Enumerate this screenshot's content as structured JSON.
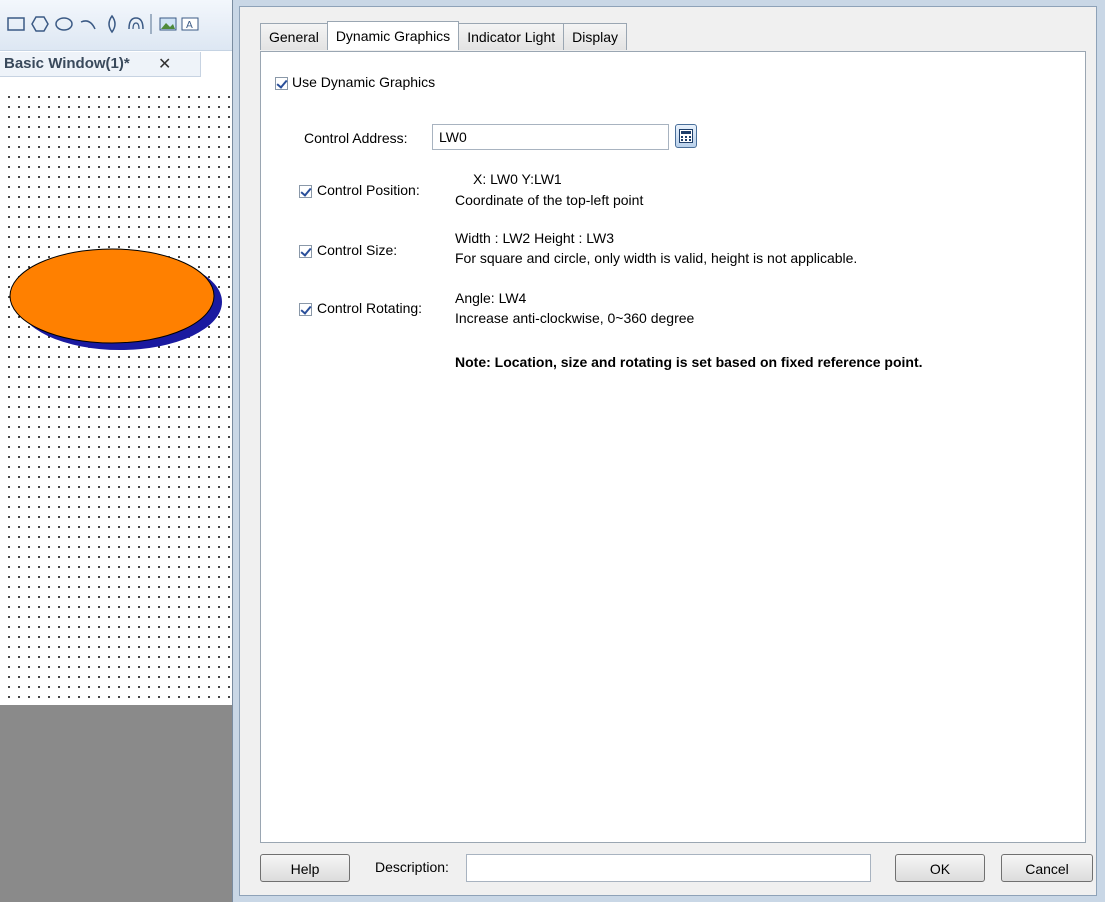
{
  "editor": {
    "toolbar_icons": [
      "rectangle-icon",
      "polygon-icon",
      "ellipse-icon",
      "arc-icon",
      "diamond-icon",
      "arch-icon",
      "image-icon",
      "text-icon"
    ],
    "doc_tab": {
      "label": "Basic Window(1)*",
      "close": "✕"
    },
    "shape": {
      "fill": "#ff8000",
      "shadow": "#1a1aa0",
      "stroke": "#000000"
    }
  },
  "dialog": {
    "tabs": [
      {
        "label": "General",
        "active": false
      },
      {
        "label": "Dynamic Graphics",
        "active": true
      },
      {
        "label": "Indicator Light",
        "active": false
      },
      {
        "label": "Display",
        "active": false
      }
    ],
    "use_dynamic": {
      "label": "Use Dynamic Graphics",
      "checked": true
    },
    "control_address": {
      "label": "Control Address:",
      "value": "LW0"
    },
    "rows": [
      {
        "label": "Control Position:",
        "checked": true,
        "line1": "X: LW0   Y:LW1",
        "line2": "Coordinate of the top-left point"
      },
      {
        "label": "Control Size:",
        "checked": true,
        "line1": "Width : LW2   Height : LW3",
        "line2": "For square and circle, only width is valid, height is not applicable."
      },
      {
        "label": "Control Rotating:",
        "checked": true,
        "line1": "Angle: LW4",
        "line2": "Increase anti-clockwise, 0~360 degree"
      }
    ],
    "note": "Note: Location, size and rotating is set based on fixed reference point.",
    "footer": {
      "help": "Help",
      "description_label": "Description:",
      "description_value": "",
      "ok": "OK",
      "cancel": "Cancel"
    }
  }
}
